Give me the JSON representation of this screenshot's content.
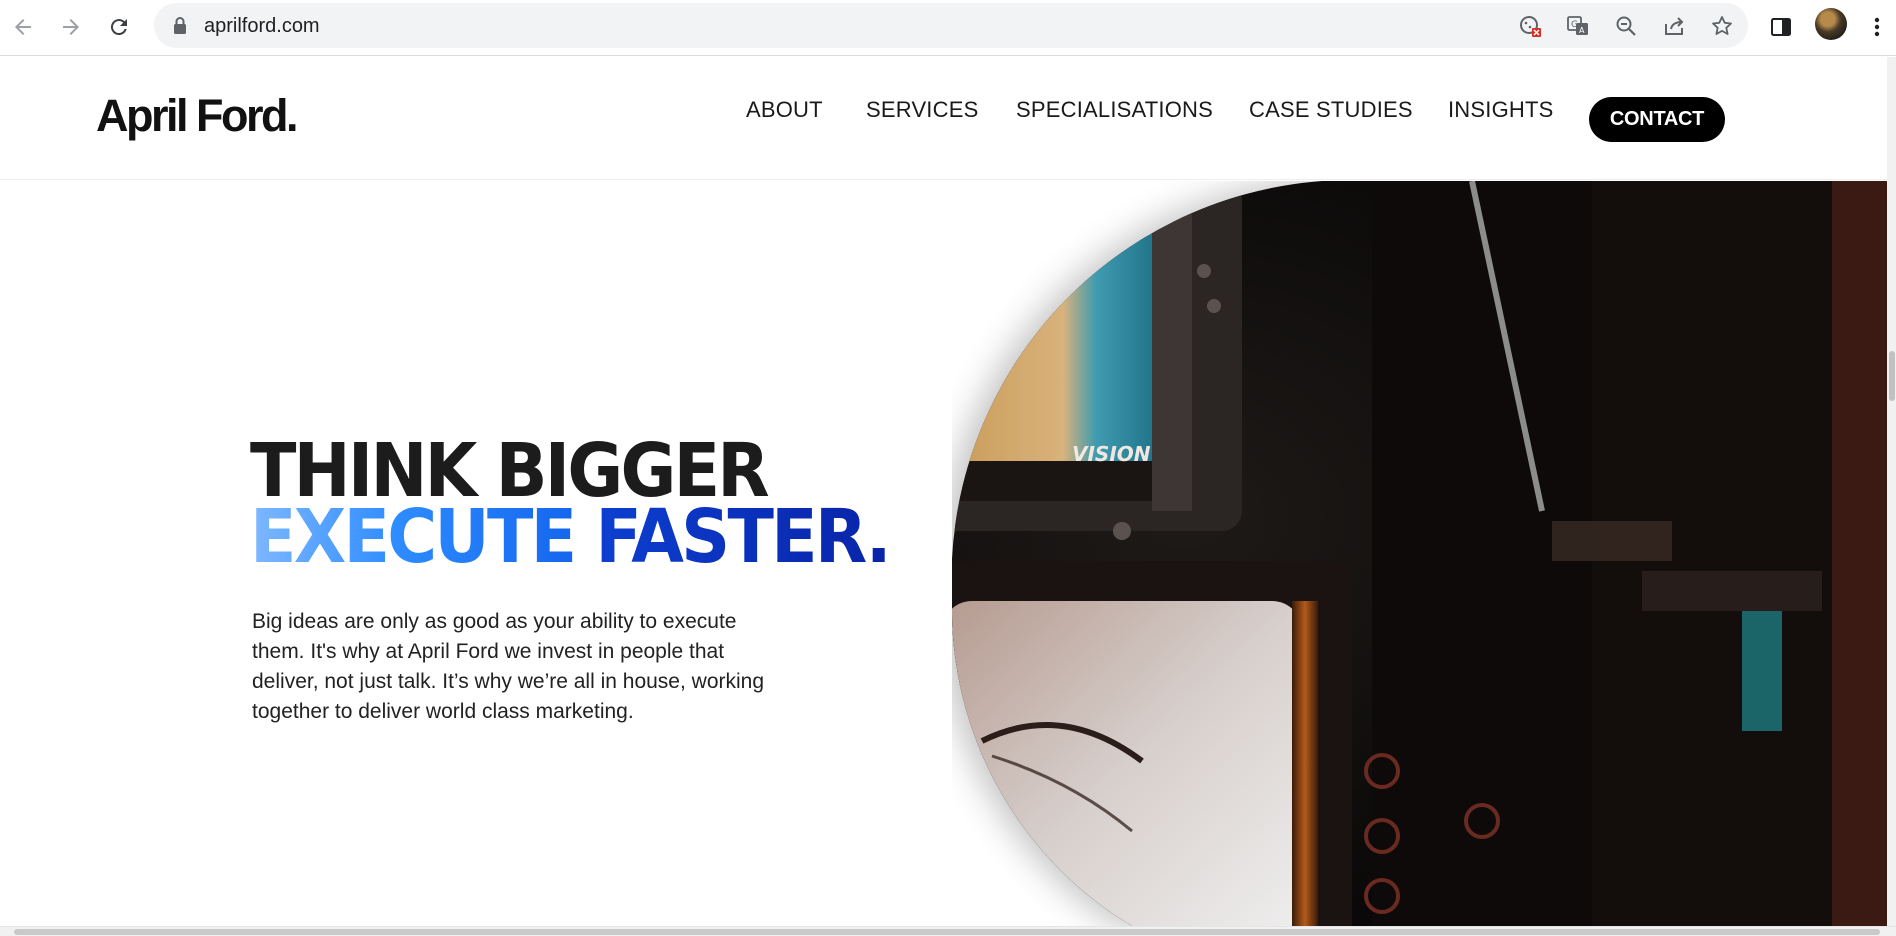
{
  "browser": {
    "url": "aprilford.com",
    "icons": [
      "back-icon",
      "forward-icon",
      "reload-icon",
      "lock-icon",
      "cookie-blocked-icon",
      "translate-icon",
      "zoom-icon",
      "share-icon",
      "bookmark-star-icon",
      "side-panel-icon",
      "profile-avatar",
      "menu-icon"
    ]
  },
  "header": {
    "logo": "April Ford.",
    "nav": [
      "ABOUT",
      "SERVICES",
      "SPECIALISATIONS",
      "CASE STUDIES",
      "INSIGHTS"
    ],
    "contact": "CONTACT"
  },
  "hero": {
    "line1": "THINK BIGGER",
    "line2_word1": "EXECUTE",
    "line2_word2": "FASTER.",
    "intro": "Big ideas are only as good as your ability to execute them. It's why at April Ford we invest in people that deliver, not just talk. It’s why we’re all in house, working together to deliver world class marketing.",
    "tv_text": "VISION"
  },
  "colors": {
    "accent_light": "#2e8cff",
    "accent_dark": "#0824a8",
    "contact_bg": "#000000"
  }
}
